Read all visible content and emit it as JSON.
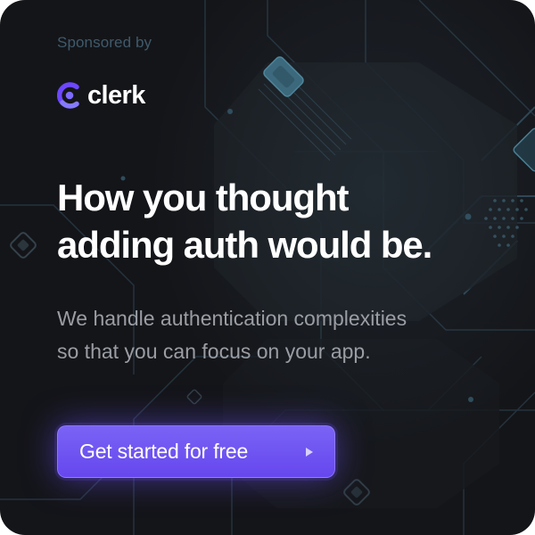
{
  "sponsor": {
    "label": "Sponsored by"
  },
  "brand": {
    "name": "clerk",
    "accent": "#6c47ff"
  },
  "headline": {
    "line1": "How you thought",
    "line2": "adding auth would be."
  },
  "subtext": {
    "line1": "We handle authentication complexities",
    "line2": "so that you can focus on your app."
  },
  "cta": {
    "label": "Get started for free",
    "icon": "play-arrow-icon",
    "color": "#6c47ff"
  },
  "colors": {
    "background": "#141519",
    "circuit": "#2c3f4c",
    "sponsor_text": "#3f5a6b",
    "subtext": "#9b9da4"
  }
}
